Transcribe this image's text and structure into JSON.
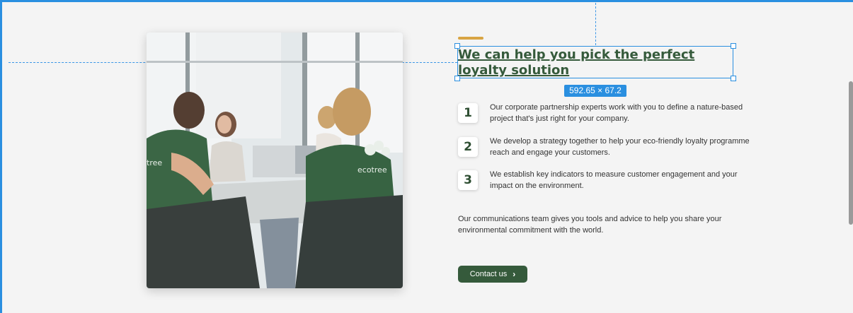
{
  "section": {
    "heading": "We can help you pick the perfect loyalty solution",
    "selection_size": "592.65 × 67.2",
    "steps": [
      {
        "number": "1",
        "text": "Our corporate partnership experts work with you to define a nature-based project that's just right for your company."
      },
      {
        "number": "2",
        "text": "We develop a strategy together to help your eco-friendly loyalty programme reach and engage your customers."
      },
      {
        "number": "3",
        "text": "We establish key indicators to measure customer engagement and your impact on the environment."
      }
    ],
    "communications": "Our communications team gives you tools and advice to help you share your environmental commitment with the world.",
    "cta_label": "Contact us",
    "cta_icon": "chevron-right-icon"
  },
  "photo": {
    "shirt_brand": "ecotree",
    "shirt_brand_partial": "tree"
  },
  "colors": {
    "brand_green": "#355a3b",
    "accent_gold": "#d8a443",
    "selection_blue": "#2a8fe0"
  }
}
